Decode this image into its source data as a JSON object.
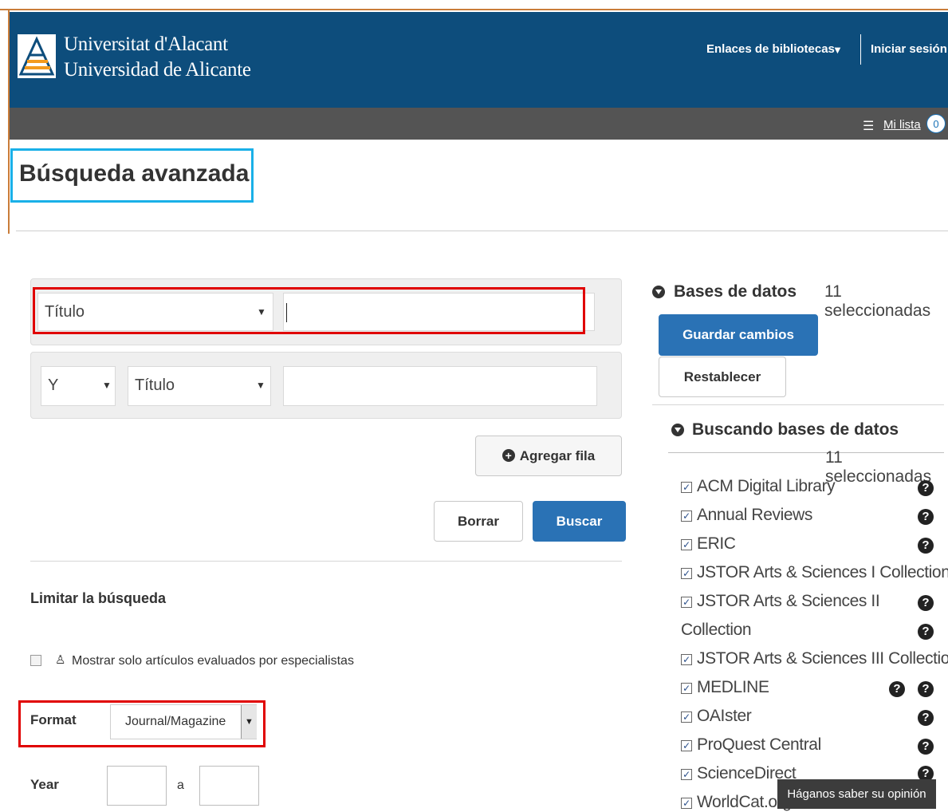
{
  "header": {
    "logo_line1": "Universitat d'Alacant",
    "logo_line2": "Universidad de Alicante",
    "links_label": "Enlaces de bibliotecas",
    "login_label": "Iniciar sesión"
  },
  "toolbar": {
    "my_list_label": "Mi lista",
    "my_list_count": "0"
  },
  "page": {
    "title": "Búsqueda avanzada"
  },
  "search": {
    "row1_field": "Título",
    "row1_value": "",
    "row2_operator": "Y",
    "row2_field": "Título",
    "row2_value": "",
    "add_row_label": "Agregar fila",
    "clear_label": "Borrar",
    "search_label": "Buscar"
  },
  "limits": {
    "heading": "Limitar la búsqueda",
    "peer_reviewed_label": "Mostrar solo artículos evaluados por especialistas",
    "format_label": "Format",
    "format_value": "Journal/Magazine",
    "year_label": "Year",
    "year_separator": "a"
  },
  "sidebar": {
    "databases_heading": "Bases de datos",
    "databases_count": "11 seleccionadas",
    "save_label": "Guardar cambios",
    "reset_label": "Restablecer",
    "searching_heading": "Buscando bases de datos",
    "searching_count": "11 seleccionadas",
    "items": [
      {
        "label": "ACM Digital Library"
      },
      {
        "label": "Annual Reviews"
      },
      {
        "label": "ERIC"
      },
      {
        "label": "JSTOR Arts & Sciences I Collection"
      },
      {
        "label": "JSTOR Arts & Sciences II"
      },
      {
        "label": "Collection"
      },
      {
        "label": "JSTOR Arts & Sciences III Collection"
      },
      {
        "label": "MEDLINE"
      },
      {
        "label": "OAIster"
      },
      {
        "label": "ProQuest Central"
      },
      {
        "label": "ScienceDirect"
      },
      {
        "label": "WorldCat.org"
      }
    ]
  },
  "feedback": {
    "label": "Háganos saber su opinión"
  },
  "colors": {
    "header_bg": "#0d4d7c",
    "toolbar_bg": "#545454",
    "primary_button": "#2a72b5",
    "highlight_red": "#e00000",
    "highlight_blue": "#1ab0e8"
  }
}
